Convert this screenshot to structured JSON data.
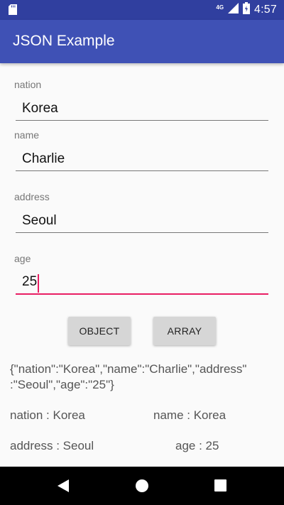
{
  "status_bar": {
    "network": "4G",
    "time": "4:57",
    "icons": [
      "sd-card-icon",
      "signal-icon",
      "battery-icon"
    ]
  },
  "app_bar": {
    "title": "JSON Example"
  },
  "form": {
    "nation": {
      "label": "nation",
      "value": "Korea"
    },
    "name": {
      "label": "name",
      "value": "Charlie"
    },
    "address": {
      "label": "address",
      "value": "Seoul"
    },
    "age": {
      "label": "age",
      "value": "25"
    }
  },
  "buttons": {
    "object": "OBJECT",
    "array": "ARRAY"
  },
  "results": {
    "json_line1": "{\"nation\":\"Korea\",\"name\":\"Charlie\",\"address\"",
    "json_line2": ":\"Seoul\",\"age\":\"25\"}",
    "nation": "nation : Korea",
    "name": "name : Korea",
    "address": "address : Seoul",
    "age": "age : 25"
  },
  "colors": {
    "status_bar": "#303f9f",
    "app_bar": "#3f51b5",
    "accent": "#e91e63",
    "button": "#d6d6d6"
  },
  "nav_icons": [
    "back-icon",
    "home-icon",
    "recents-icon"
  ]
}
